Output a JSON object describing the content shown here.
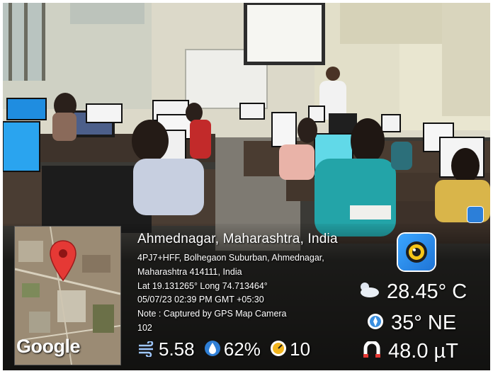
{
  "map": {
    "watermark": "Google",
    "pin_color": "#e53935"
  },
  "location": {
    "city_line": "Ahmednagar, Maharashtra, India",
    "address_line_1": "4PJ7+HFF, Bolhegaon Suburban, Ahmednagar,",
    "address_line_2": "Maharashtra 414111, India",
    "coords": "Lat 19.131265° Long 74.713464°",
    "datetime": "05/07/23 02:39 PM GMT +05:30",
    "note": "Note : Captured by GPS Map Camera",
    "extra": "102"
  },
  "weather": {
    "temperature": "28.45° C",
    "wind_direction": "35° NE",
    "magnetic": "48.0 µT",
    "wind_speed": "5.58",
    "humidity": "62%",
    "pressure": "10"
  },
  "icons": {
    "app": "gps-map-camera-icon",
    "cloud": "cloud-sun-icon",
    "compass": "compass-icon",
    "magnet": "magnet-icon",
    "wind": "wind-icon",
    "humidity": "humidity-icon",
    "gauge": "gauge-icon"
  }
}
